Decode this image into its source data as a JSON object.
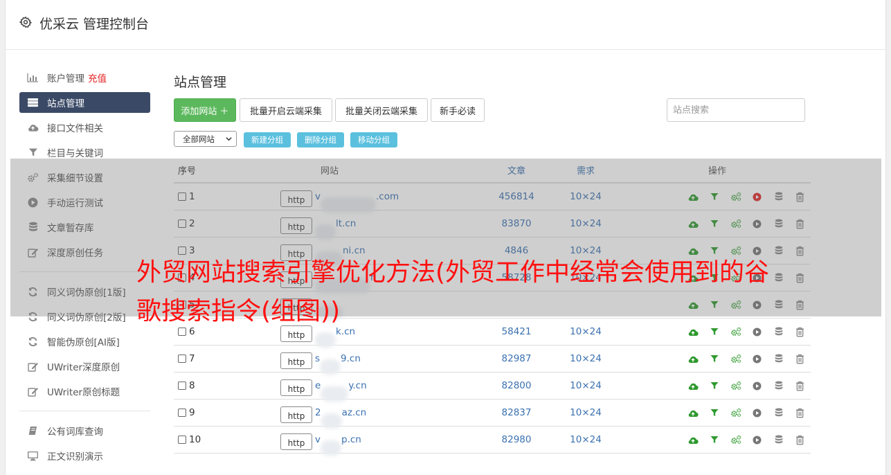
{
  "app": {
    "title": "优采云 管理控制台"
  },
  "sidebar": {
    "group1": [
      {
        "label": "账户管理",
        "extra": "充值",
        "icon": "bar-chart-icon"
      },
      {
        "label": "站点管理",
        "icon": "server-icon",
        "active": true
      },
      {
        "label": "接口文件相关",
        "icon": "cloud-upload-icon"
      },
      {
        "label": "栏目与关键词",
        "icon": "filter-icon"
      },
      {
        "label": "采集细节设置",
        "icon": "cogs-icon"
      },
      {
        "label": "手动运行测试",
        "icon": "play-circle-icon"
      },
      {
        "label": "文章暂存库",
        "icon": "database-icon"
      },
      {
        "label": "深度原创任务",
        "icon": "edit-icon"
      }
    ],
    "group2": [
      {
        "label": "同义词伪原创[1版]",
        "icon": "refresh-icon"
      },
      {
        "label": "同义词伪原创[2版]",
        "icon": "refresh-icon"
      },
      {
        "label": "智能伪原创[AI版]",
        "icon": "refresh-icon"
      },
      {
        "label": "UWriter深度原创",
        "icon": "edit-icon"
      },
      {
        "label": "UWriter原创标题",
        "icon": "edit-icon"
      }
    ],
    "group3": [
      {
        "label": "公有词库查询",
        "icon": "book-icon"
      },
      {
        "label": "正文识别演示",
        "icon": "monitor-icon"
      }
    ]
  },
  "main": {
    "title": "站点管理",
    "toolbar": {
      "add": "添加网站 ＋",
      "batch_open": "批量开启云端采集",
      "batch_close": "批量关闭云端采集",
      "guide": "新手必读",
      "search_placeholder": "站点搜索"
    },
    "group_select": "全部网站",
    "group_buttons": {
      "new": "新建分组",
      "delete": "删除分组",
      "move": "移动分组"
    },
    "table": {
      "headers": {
        "no": "序号",
        "site": "网站",
        "articles": "文章",
        "demand": "需求",
        "ops": "操作"
      },
      "http_label": "http",
      "rows": [
        {
          "no": "1",
          "domain_prefix": "v",
          "domain": ".com",
          "articles": "456814",
          "demand": "10×24",
          "running": true
        },
        {
          "no": "2",
          "domain_prefix": "",
          "domain": "lt.cn",
          "articles": "83870",
          "demand": "10×24",
          "running": false
        },
        {
          "no": "3",
          "domain_prefix": "",
          "domain": "ni.cn",
          "articles": "4846",
          "demand": "10×24",
          "running": false
        },
        {
          "no": "4",
          "domain_prefix": "",
          "domain": "n",
          "articles": "58728",
          "demand": "10×24",
          "running": false
        },
        {
          "no": "5",
          "domain_prefix": "",
          "domain": "",
          "articles": "",
          "demand": "",
          "running": false
        },
        {
          "no": "6",
          "domain_prefix": "",
          "domain": "k.cn",
          "articles": "58421",
          "demand": "10×24",
          "running": false
        },
        {
          "no": "7",
          "domain_prefix": "s",
          "domain": "9.cn",
          "articles": "82987",
          "demand": "10×24",
          "running": false
        },
        {
          "no": "8",
          "domain_prefix": "e",
          "domain": "y.cn",
          "articles": "82800",
          "demand": "10×24",
          "running": false
        },
        {
          "no": "9",
          "domain_prefix": "2",
          "domain": "az.cn",
          "articles": "82837",
          "demand": "10×24",
          "running": false
        },
        {
          "no": "10",
          "domain_prefix": "v",
          "domain": "p.cn",
          "articles": "82980",
          "demand": "10×24",
          "running": false
        }
      ]
    }
  },
  "overlay": {
    "headline": "外贸网站搜索引擎优化方法(外贸工作中经常会使用到的谷歌搜索指令(组图))"
  },
  "colors": {
    "sidebar_active": "#3a4a66",
    "green_button": "#5cb85c",
    "info_button": "#5bc0de",
    "link": "#3a70b0",
    "icon_green": "#2f9a2f",
    "play_red": "#e02828",
    "overlay_text": "#ff1010"
  }
}
